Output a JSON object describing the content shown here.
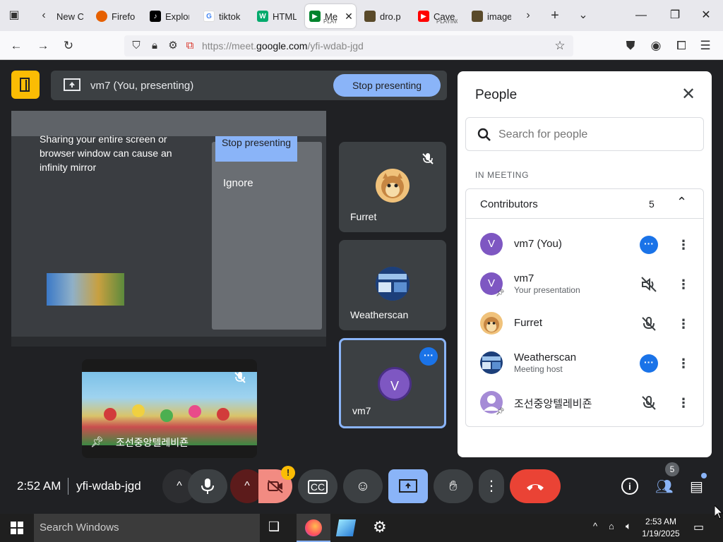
{
  "browser": {
    "tabs": [
      {
        "label": "New C",
        "icon": "firefox-newtab-icon"
      },
      {
        "label": "Firefo",
        "icon": "firefox-icon"
      },
      {
        "label": "Explor",
        "icon": "tiktok-icon"
      },
      {
        "label": "tiktok",
        "icon": "google-icon"
      },
      {
        "label": "HTML",
        "icon": "w3schools-icon"
      },
      {
        "label": "Me",
        "sub": "PLAY",
        "icon": "meet-icon",
        "active": true
      },
      {
        "label": "dro.p",
        "icon": "image-icon"
      },
      {
        "label": "Cave",
        "sub": "PLAYING",
        "icon": "youtube-icon"
      },
      {
        "label": "image",
        "icon": "image-icon"
      }
    ],
    "url_prefix": "https://meet.",
    "url_domain": "google.com",
    "url_path": "/yfi-wdab-jgd"
  },
  "meet": {
    "presenting_label": "vm7 (You, presenting)",
    "stop_presenting": "Stop presenting",
    "warning": {
      "message": "Sharing your entire screen or browser window can cause an infinity mirror",
      "stop_label": "Stop presenting",
      "ignore_label": "Ignore"
    },
    "tiles": [
      {
        "name": "Furret",
        "muted": true
      },
      {
        "name": "Weatherscan",
        "muted": false
      },
      {
        "name": "vm7",
        "initial": "V",
        "speaking": true
      }
    ],
    "video_tile_name": "조선중앙텔레비죤",
    "clock": "2:52 AM",
    "meeting_code": "yfi-wdab-jgd",
    "people_count_badge": "5"
  },
  "people_panel": {
    "title": "People",
    "search_placeholder": "Search for people",
    "section": "IN MEETING",
    "group_label": "Contributors",
    "group_count": "5",
    "participants": [
      {
        "name": "vm7 (You)",
        "sub": "",
        "initial": "V",
        "action": "more-icon"
      },
      {
        "name": "vm7",
        "sub": "Your presentation",
        "initial": "V",
        "action": "presentation-muted-icon"
      },
      {
        "name": "Furret",
        "sub": "",
        "initial": "",
        "action": "mic-off-icon"
      },
      {
        "name": "Weatherscan",
        "sub": "Meeting host",
        "initial": "",
        "action": "more-icon"
      },
      {
        "name": "조선중앙텔레비죤",
        "sub": "",
        "initial": "",
        "action": "mic-off-icon"
      }
    ]
  },
  "taskbar": {
    "search_placeholder": "Search Windows",
    "time": "2:53 AM",
    "date": "1/19/2025"
  },
  "colors": {
    "meet_bg": "#202124",
    "accent_blue": "#8ab4f8",
    "end_call_red": "#ea4335",
    "avatar_purple": "#7e57c2"
  }
}
